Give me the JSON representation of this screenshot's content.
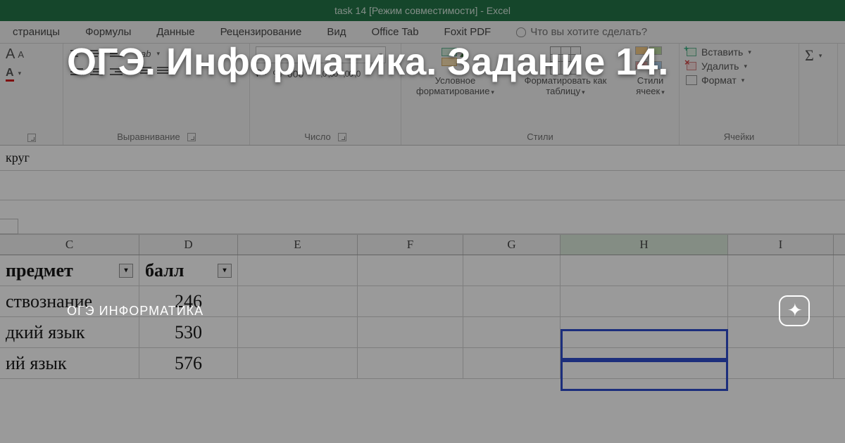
{
  "titlebar": "task 14  [Режим совместимости] - Excel",
  "tabs": {
    "t0": "страницы",
    "t1": "Формулы",
    "t2": "Данные",
    "t3": "Рецензирование",
    "t4": "Вид",
    "t5": "Office Tab",
    "t6": "Foxit PDF",
    "tell": "Что вы хотите сделать?"
  },
  "ribbon": {
    "font_label": "",
    "align_label": "Выравнивание",
    "number_label": "Число",
    "number_format": "",
    "pct": "%",
    "thou": "000",
    "dec_inc": ",0 ,00",
    "dec_dec": ",00 ,0",
    "currency": "₽",
    "styles_label": "Стили",
    "cond": "Условное форматирование",
    "fmt_table": "Форматировать как таблицу",
    "cell_styles": "Стили ячеек",
    "cells_label": "Ячейки",
    "insert": "Вставить",
    "delete": "Удалить",
    "format": "Формат",
    "sigma": "Σ"
  },
  "fx": "круг",
  "cols": {
    "c": "C",
    "d": "D",
    "e": "E",
    "f": "F",
    "g": "G",
    "h": "H",
    "i": "I"
  },
  "headers": {
    "c": "предмет",
    "d": "балл"
  },
  "rows": [
    {
      "c": "ствознание",
      "d": "246"
    },
    {
      "c": "дкий язык",
      "d": "530"
    },
    {
      "c": "ий язык",
      "d": "576"
    }
  ],
  "overlay": {
    "headline": "ОГЭ. Информатика. Задание 14.",
    "subtag": "ОГЭ ИНФОРМАТИКА"
  }
}
